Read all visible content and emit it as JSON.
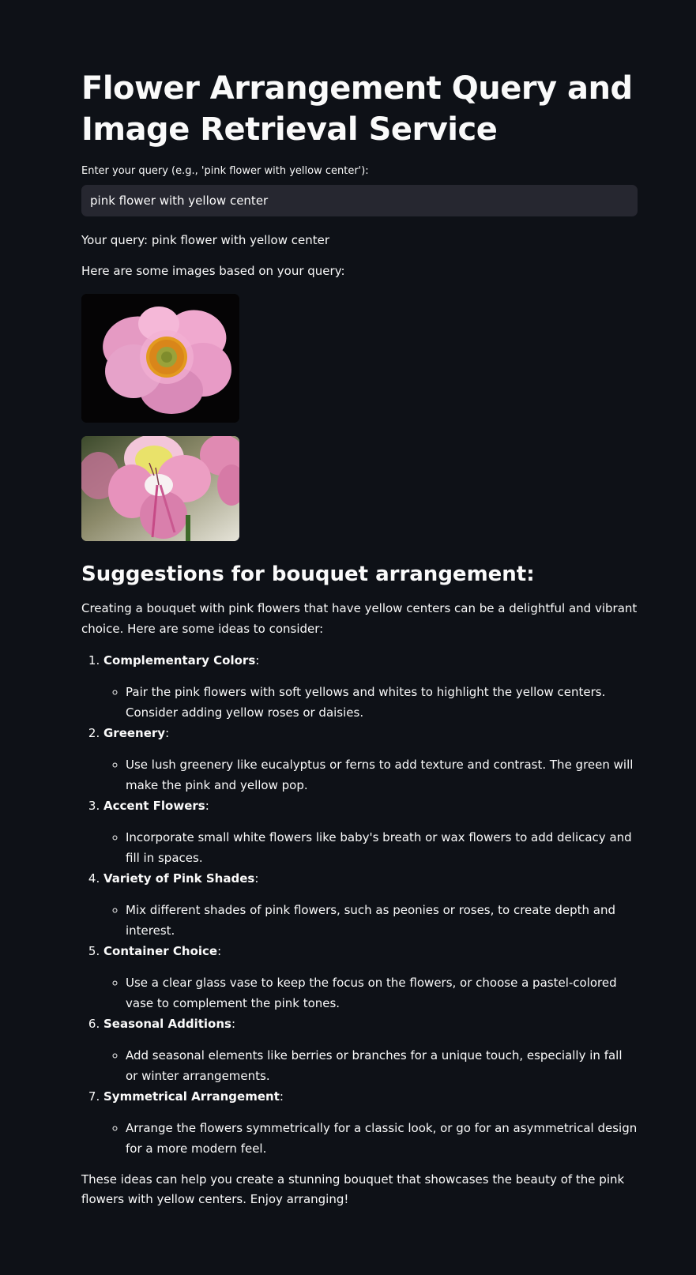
{
  "header": {
    "title": "Flower Arrangement Query and Image Retrieval Service"
  },
  "query": {
    "label": "Enter your query (e.g., 'pink flower with yellow center'):",
    "value": "pink flower with yellow center",
    "echo": "Your query: pink flower with yellow center",
    "images_intro": "Here are some images based on your query:"
  },
  "images": [
    {
      "name": "pink anemone flower with yellow center"
    },
    {
      "name": "pink alstroemeria flower with yellow throat"
    }
  ],
  "suggestions": {
    "heading": "Suggestions for bouquet arrangement:",
    "intro": "Creating a bouquet with pink flowers that have yellow centers can be a delightful and vibrant choice. Here are some ideas to consider:",
    "items": [
      {
        "title": "Complementary Colors",
        "detail": "Pair the pink flowers with soft yellows and whites to highlight the yellow centers. Consider adding yellow roses or daisies."
      },
      {
        "title": "Greenery",
        "detail": "Use lush greenery like eucalyptus or ferns to add texture and contrast. The green will make the pink and yellow pop."
      },
      {
        "title": "Accent Flowers",
        "detail": "Incorporate small white flowers like baby's breath or wax flowers to add delicacy and fill in spaces."
      },
      {
        "title": "Variety of Pink Shades",
        "detail": "Mix different shades of pink flowers, such as peonies or roses, to create depth and interest."
      },
      {
        "title": "Container Choice",
        "detail": "Use a clear glass vase to keep the focus on the flowers, or choose a pastel-colored vase to complement the pink tones."
      },
      {
        "title": "Seasonal Additions",
        "detail": "Add seasonal elements like berries or branches for a unique touch, especially in fall or winter arrangements."
      },
      {
        "title": "Symmetrical Arrangement",
        "detail": "Arrange the flowers symmetrically for a classic look, or go for an asymmetrical design for a more modern feel."
      }
    ],
    "closing": "These ideas can help you create a stunning bouquet that showcases the beauty of the pink flowers with yellow centers. Enjoy arranging!"
  },
  "colors": {
    "background": "#0e1117",
    "input_background": "#262730",
    "text": "#fafafa"
  }
}
